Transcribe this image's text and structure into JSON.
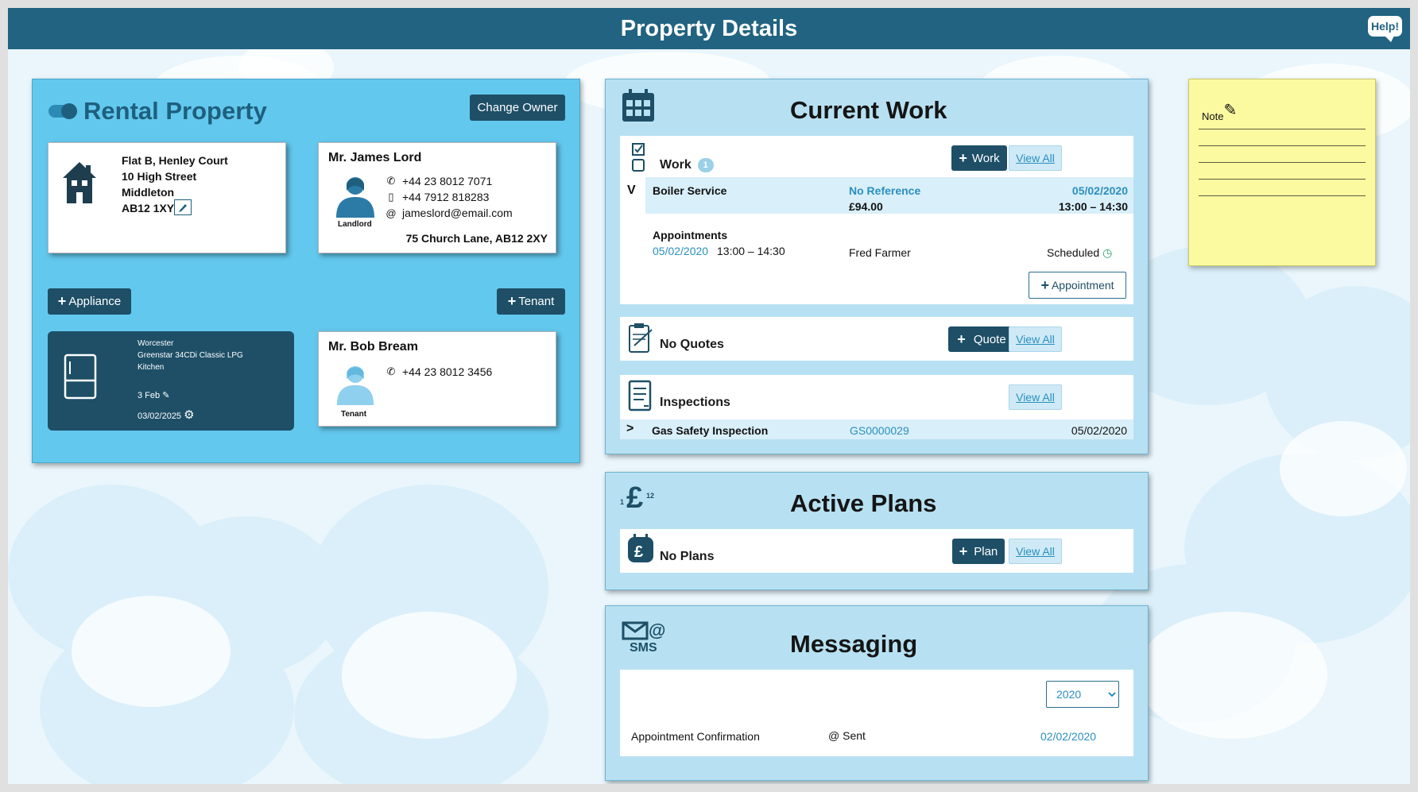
{
  "header": {
    "title": "Property Details",
    "help_label": "Help!"
  },
  "rental": {
    "title": "Rental Property",
    "change_owner_label": "Change Owner",
    "address": {
      "line1": "Flat B, Henley Court",
      "line2": "10 High Street",
      "line3": "Middleton",
      "postcode": "AB12 1XY"
    },
    "landlord": {
      "name": "Mr. James Lord",
      "role": "Landlord",
      "phone": "+44 23 8012 7071",
      "mobile": "+44 7912 818283",
      "email": "jameslord@email.com",
      "address": "75 Church Lane, AB12 2XY"
    },
    "add_appliance_label": "Appliance",
    "add_tenant_label": "Tenant",
    "appliance": {
      "make": "Worcester",
      "model": "Greenstar 34CDi Classic LPG",
      "location": "Kitchen",
      "service_date": "3 Feb",
      "next_date": "03/02/2025"
    },
    "tenant": {
      "name": "Mr. Bob Bream",
      "role": "Tenant",
      "phone": "+44 23 8012 3456"
    }
  },
  "current_work": {
    "title": "Current Work",
    "work": {
      "label": "Work",
      "count": "1",
      "add_label": "Work",
      "view_all": "View All",
      "job": {
        "toggle": "V",
        "name": "Boiler Service",
        "reference": "No Reference",
        "price": "£94.00",
        "date": "05/02/2020",
        "time": "13:00 – 14:30"
      },
      "appointments_label": "Appointments",
      "appointment": {
        "date": "05/02/2020",
        "time": "13:00 – 14:30",
        "engineer": "Fred Farmer",
        "status": "Scheduled"
      },
      "add_appointment_label": "Appointment"
    },
    "quotes": {
      "label": "No Quotes",
      "add_label": "Quote",
      "view_all": "View All"
    },
    "inspections": {
      "label": "Inspections",
      "view_all": "View All",
      "row": {
        "toggle": ">",
        "name": "Gas Safety Inspection",
        "reference": "GS0000029",
        "date": "05/02/2020"
      }
    }
  },
  "active_plans": {
    "title": "Active Plans",
    "label": "No Plans",
    "add_label": "Plan",
    "view_all": "View All",
    "icon_text": "12"
  },
  "messaging": {
    "title": "Messaging",
    "icon_text": "SMS",
    "year_selected": "2020",
    "row": {
      "name": "Appointment Confirmation",
      "status": "Sent",
      "date": "02/02/2020"
    }
  },
  "note": {
    "title": "Note"
  },
  "icons": [
    "house-icon",
    "edit-icon",
    "person-icon",
    "phone-icon",
    "mobile-icon",
    "email-icon",
    "plus-icon",
    "fridge-icon",
    "wrench-icon",
    "gear-icon",
    "calendar-icon",
    "checklist-icon",
    "clock-icon",
    "clipboard-icon",
    "document-icon",
    "pound-icon",
    "envelope-icon",
    "pencil-icon"
  ],
  "colors": {
    "header": "#216381",
    "rental_panel": "#63c8ee",
    "dark_button": "#1e4f67",
    "panel": "#b7e1f2",
    "link": "#2a8fbf",
    "note": "#fbfaa0"
  }
}
